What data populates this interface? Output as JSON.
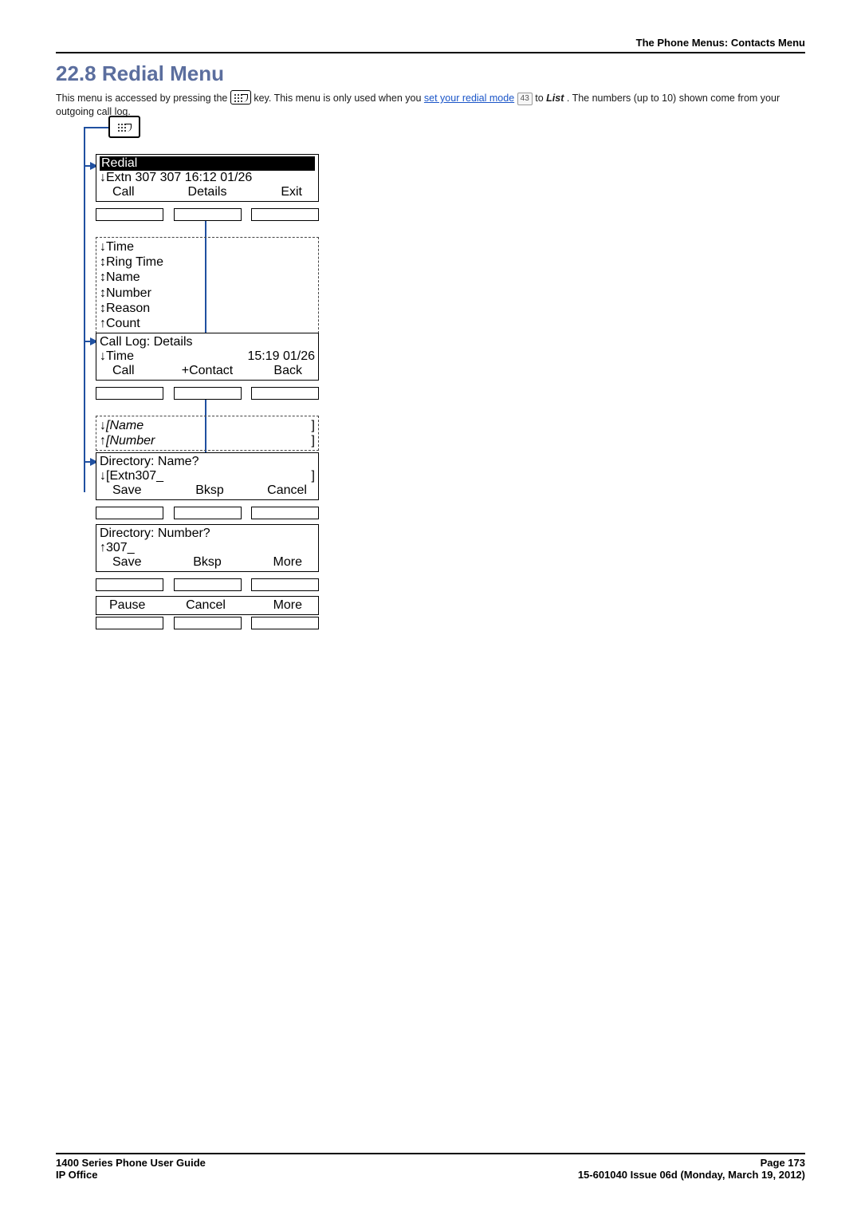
{
  "header": {
    "breadcrumb": "The Phone Menus: Contacts Menu"
  },
  "section": {
    "number": "22.8",
    "title": "Redial Menu"
  },
  "intro": {
    "text1": "This menu is accessed by pressing the ",
    "text2": " key. This menu is only used when you ",
    "link": "set your redial mode",
    "page_ref": "43",
    "text3": " to ",
    "list_word": "List",
    "text4": ". The numbers (up to 10) shown come from your outgoing call log."
  },
  "diagram": {
    "screen1": {
      "title": "Redial",
      "line": "↓Extn 307   307   16:12 01/26",
      "softkeys": [
        "Call",
        "Details",
        "Exit"
      ]
    },
    "box1": {
      "items": [
        "↓Time",
        "↕Ring Time",
        "↕Name",
        "↕Number",
        "↕Reason",
        "↑Count"
      ]
    },
    "screen2": {
      "title": "Call Log: Details",
      "line_left": "↓Time",
      "line_right": "15:19  01/26",
      "softkeys": [
        "Call",
        "+Contact",
        "Back"
      ]
    },
    "box2": {
      "items": [
        "↓[Name",
        "↑[Number"
      ],
      "brackets": [
        "]",
        "]"
      ]
    },
    "screen3": {
      "title": "Directory: Name?",
      "line_left": "↓[Extn307_",
      "line_right": "]",
      "softkeys": [
        "Save",
        "Bksp",
        "Cancel"
      ]
    },
    "screen4": {
      "title": "Directory: Number?",
      "line": "↑307_",
      "softkeys": [
        "Save",
        "Bksp",
        "More"
      ]
    },
    "screen5": {
      "softkeys": [
        "Pause",
        "Cancel",
        "More"
      ]
    }
  },
  "footer": {
    "guide": "1400 Series Phone User Guide",
    "product": "IP Office",
    "page": "Page 173",
    "issue": "15-601040 Issue 06d (Monday, March 19, 2012)"
  }
}
